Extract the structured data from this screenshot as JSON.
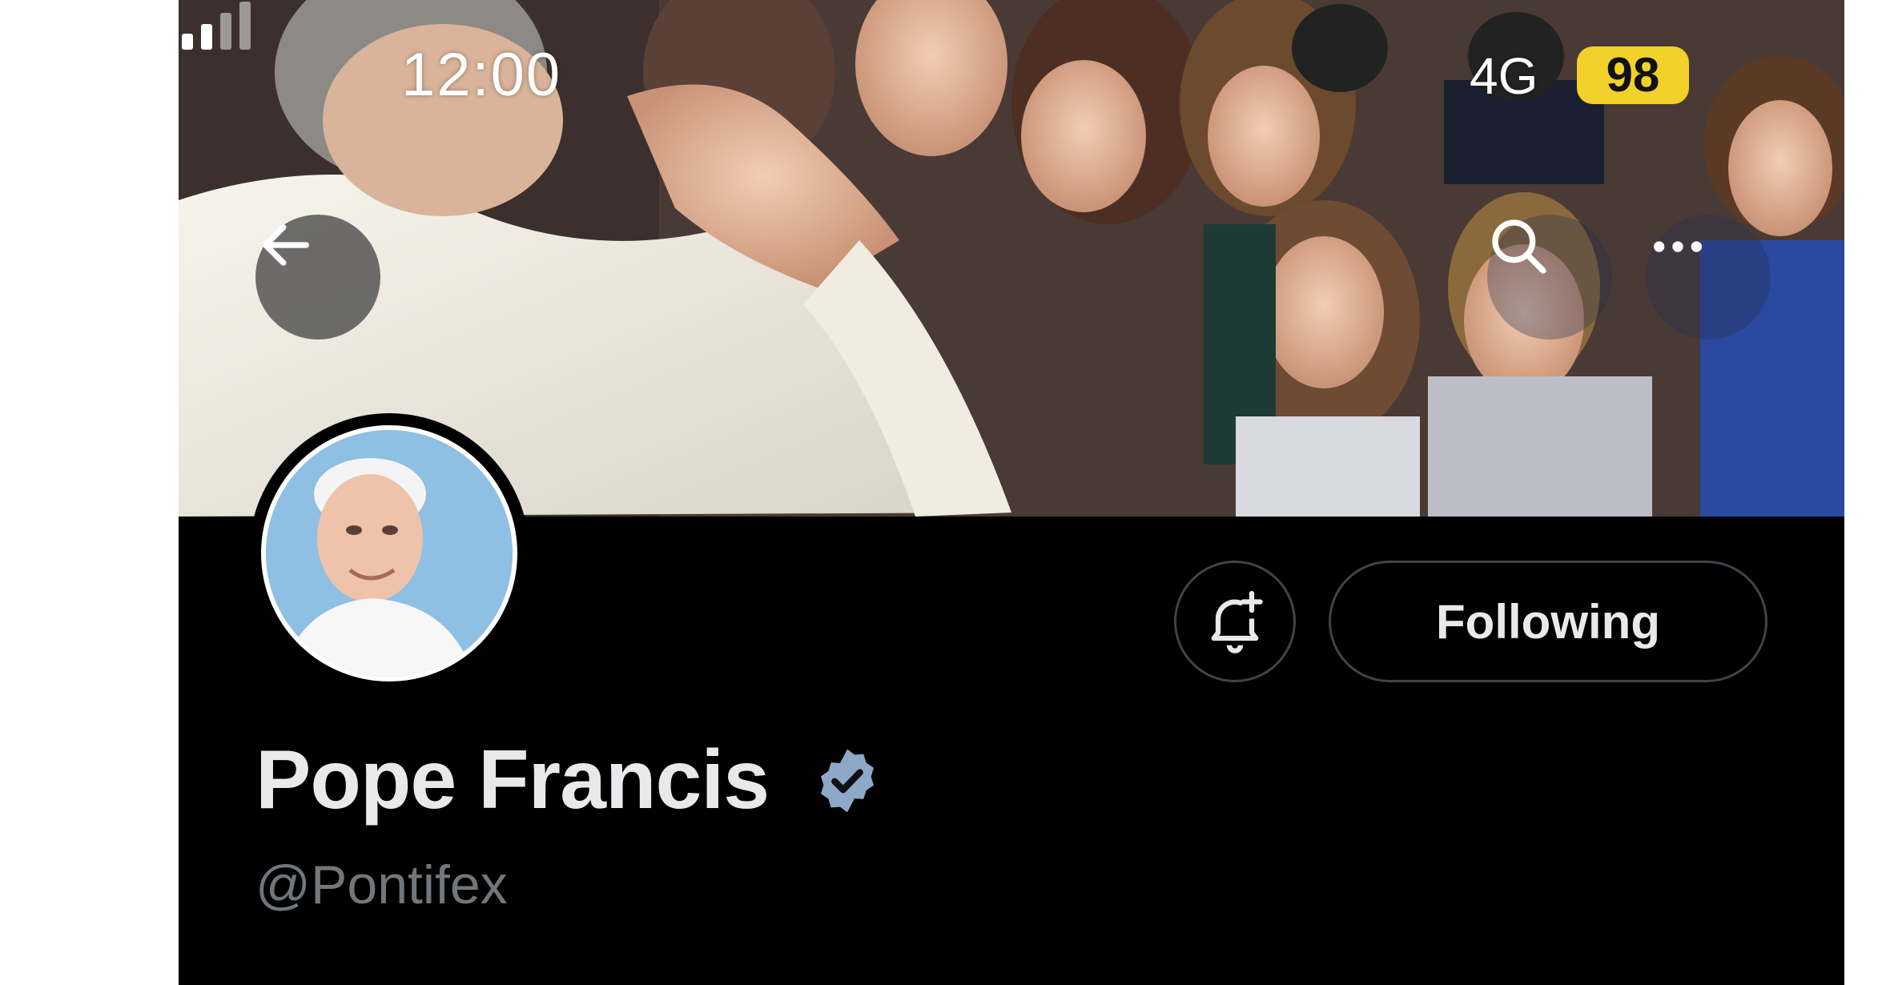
{
  "status_bar": {
    "time": "12:00",
    "network": "4G",
    "battery": "98"
  },
  "header": {
    "back_icon": "arrow-left-icon",
    "search_icon": "search-icon",
    "more_icon": "more-horizontal-icon"
  },
  "profile": {
    "display_name": "Pope Francis",
    "handle": "@Pontifex",
    "verified": true,
    "verified_icon": "verified-badge-icon",
    "notify_icon": "bell-plus-icon",
    "following_label": "Following"
  },
  "colors": {
    "background": "#000000",
    "primary_text": "#e7e9ea",
    "secondary_text": "#71767b",
    "button_border": "#3f4449",
    "battery": "#f2d12a",
    "verified": "#8ea9c8"
  }
}
